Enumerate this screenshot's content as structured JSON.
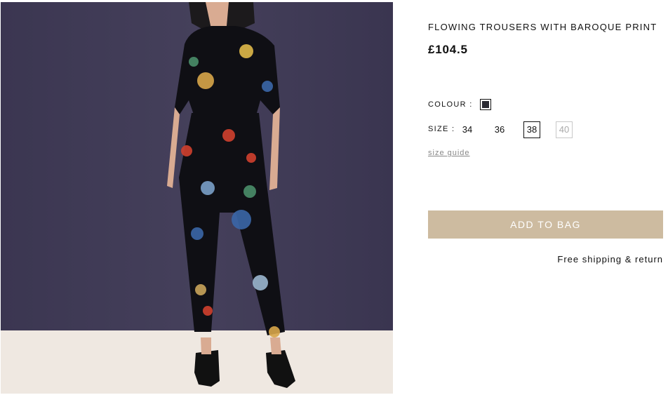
{
  "product": {
    "title": "FLOWING TROUSERS WITH BAROQUE PRINT",
    "price": "£104.5",
    "image_alt": "Model wearing flowing trousers and shirt with baroque floral print"
  },
  "colour": {
    "label": "COLOUR :",
    "swatch_color": "#2a2a33"
  },
  "size": {
    "label": "SIZE :",
    "options": [
      {
        "label": "34",
        "state": "available"
      },
      {
        "label": "36",
        "state": "available"
      },
      {
        "label": "38",
        "state": "selected"
      },
      {
        "label": "40",
        "state": "unavailable"
      }
    ],
    "guide_link": "size guide"
  },
  "actions": {
    "add_to_bag": "ADD TO BAG"
  },
  "shipping_note": "Free shipping & return",
  "colors": {
    "button": "#cdbba0",
    "backdrop_wall": "#3f3a55",
    "floor": "#efe8e1"
  }
}
